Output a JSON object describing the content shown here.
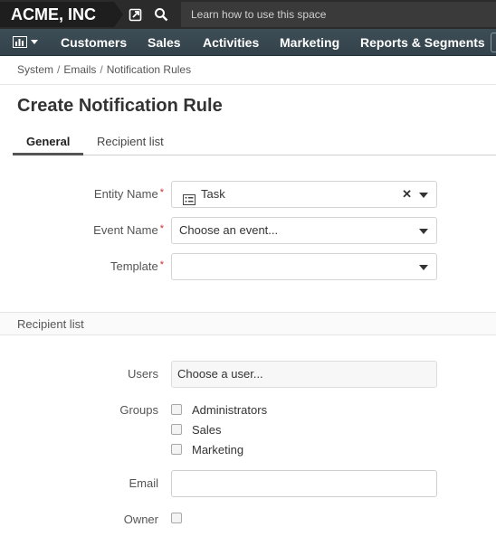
{
  "topbar": {
    "brand": "ACME, INC",
    "help_link": "Learn how to use this space",
    "icons": [
      "share-icon",
      "search-icon"
    ]
  },
  "nav": {
    "dashboard_icon": "bar-chart-icon",
    "items": [
      "Customers",
      "Sales",
      "Activities",
      "Marketing",
      "Reports & Segments"
    ]
  },
  "breadcrumb": [
    "System",
    "Emails",
    "Notification Rules"
  ],
  "page_title": "Create Notification Rule",
  "tabs": {
    "general": "General",
    "recipient": "Recipient list"
  },
  "form": {
    "entity_name": {
      "label": "Entity Name",
      "value": "Task",
      "icon": "task-list-icon"
    },
    "event_name": {
      "label": "Event Name",
      "placeholder": "Choose an event..."
    },
    "template": {
      "label": "Template",
      "value": ""
    },
    "required_mark": "*"
  },
  "recipient": {
    "section_title": "Recipient list",
    "users": {
      "label": "Users",
      "placeholder": "Choose a user..."
    },
    "groups": {
      "label": "Groups",
      "options": [
        "Administrators",
        "Sales",
        "Marketing"
      ]
    },
    "email": {
      "label": "Email",
      "value": ""
    },
    "owner": {
      "label": "Owner"
    }
  },
  "colors": {
    "topbar": "#2b2b2b",
    "navbar": "#37474f",
    "required": "#c9302c"
  }
}
